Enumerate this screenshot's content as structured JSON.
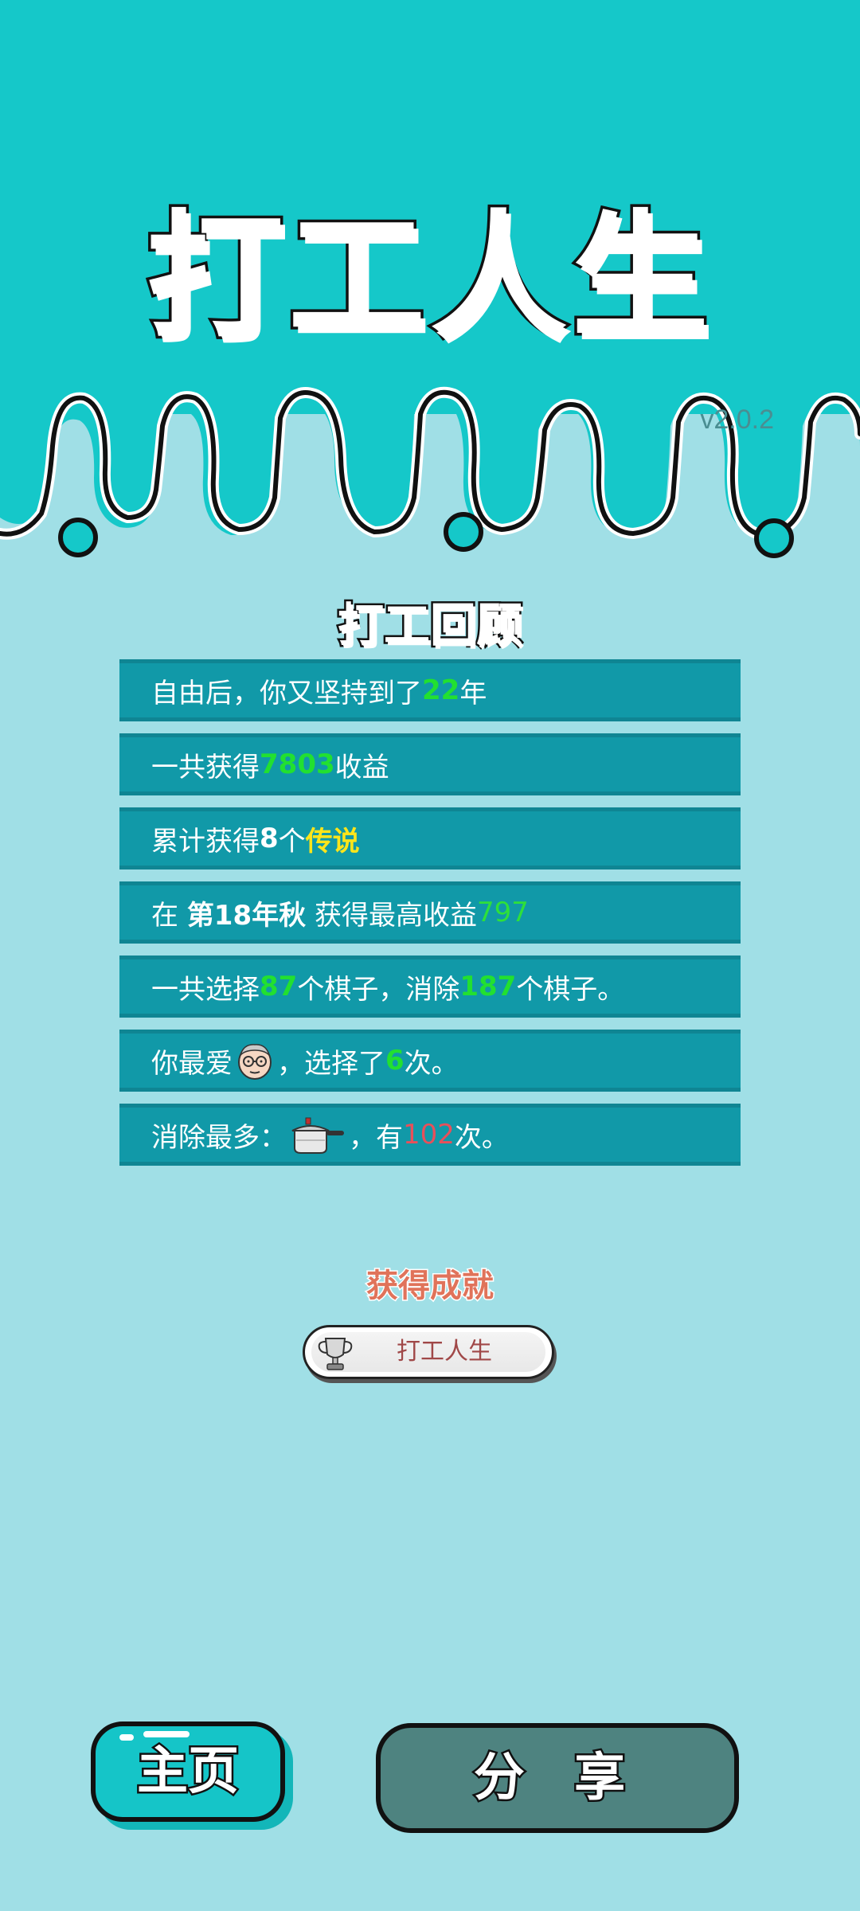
{
  "app": {
    "title": "打工人生",
    "version": "v2.0.2"
  },
  "review": {
    "heading": "打工回顾",
    "row1": {
      "pre": "自由后，你又坚持到了",
      "num": "22",
      "post": "年"
    },
    "row2": {
      "pre": "一共获得",
      "num": "7803",
      "post": "收益"
    },
    "row3": {
      "pre": "累计获得",
      "num": "8",
      "mid": "个",
      "post": "传说"
    },
    "row4": {
      "pre": "在 ",
      "season": "第18年秋",
      "mid": " 获得最高收益",
      "num": "797"
    },
    "row5": {
      "pre": "一共选择",
      "num1": "87",
      "mid": "个棋子，消除",
      "num2": "187",
      "post": "个棋子。"
    },
    "row6": {
      "pre": "你最爱",
      "mid": "，选择了",
      "num": "6",
      "post": "次。",
      "icon": "old-man-face-icon"
    },
    "row7": {
      "pre": "消除最多：",
      "mid": "，有",
      "num": "102",
      "post": "次。",
      "icon": "pressure-cooker-icon"
    }
  },
  "achievements": {
    "heading": "获得成就",
    "badge": {
      "label": "打工人生",
      "icon": "trophy-icon"
    }
  },
  "buttons": {
    "home": "主页",
    "share": "分 享"
  },
  "colors": {
    "top_bg": "#15c8c9",
    "page_bg": "#a0dfe6",
    "row_bg": "#1199a8",
    "highlight_green": "#22e030",
    "highlight_yellow": "#ffe51a",
    "highlight_red": "#e8505a"
  }
}
